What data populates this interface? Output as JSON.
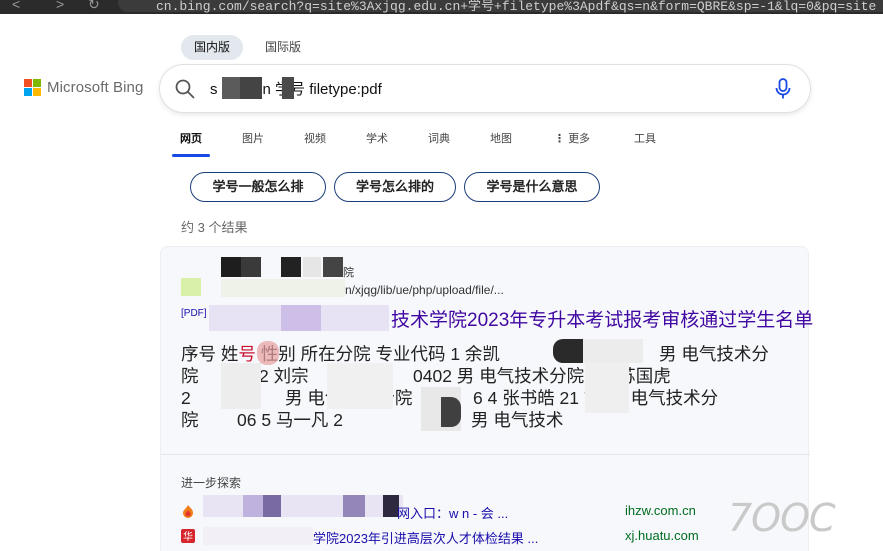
{
  "browser": {
    "url": "cn.bing.com/search?q=site%3Axjqg.edu.cn+学号+filetype%3Apdf&qs=n&form=QBRE&sp=-1&lq=0&pq=site"
  },
  "region_tabs": [
    {
      "label": "国内版",
      "active": true
    },
    {
      "label": "国际版",
      "active": false
    }
  ],
  "logo": {
    "name": "Microsoft Bing",
    "colors": [
      "#f25022",
      "#7fba00",
      "#00a4ef",
      "#ffb900"
    ]
  },
  "search": {
    "query": "s      u.cn 学号 filetype:pdf",
    "icon": "search-icon",
    "mic_icon": "microphone-icon"
  },
  "scopes": [
    {
      "label": "网页",
      "active": true
    },
    {
      "label": "图片",
      "active": false
    },
    {
      "label": "视频",
      "active": false
    },
    {
      "label": "学术",
      "active": false
    },
    {
      "label": "词典",
      "active": false
    },
    {
      "label": "地图",
      "active": false
    },
    {
      "label": "更多",
      "active": false,
      "icon": "more-vertical-icon"
    },
    {
      "label": "工具",
      "active": false
    }
  ],
  "related_chips": [
    "学号一般怎么排",
    "学号怎么排的",
    "学号是什么意思"
  ],
  "result_count": "约 3 个结果",
  "result": {
    "site_name": "院",
    "cite": "n/xjqg/lib/ue/php/upload/file/...",
    "pdf_tag": "[PDF]",
    "title": "技术学院2023年专升本考试报考审核通过学生名单",
    "snippet_rows": [
      {
        "before": "序号 姓",
        "hl": "号",
        "after": " 性别 所在分院 专业代码 1 余凯",
        "tail": "男 电气技术分"
      },
      {
        "before": "院",
        "hl": "",
        "after": "2 刘宗",
        "tail": "0402 男 电气技术分院 4        3 苏国虎"
      },
      {
        "before": "2",
        "hl": "",
        "after": "男 电气技术分院",
        "tail": "6 4 张书皓 21          76 男 电气技术分"
      },
      {
        "before": "院",
        "hl": "",
        "after": "06 5 马一凡 2",
        "tail": "男 电气技术"
      }
    ],
    "further_label": "进一步探索",
    "related": [
      {
        "text": "网入口：w           n - 会 ...",
        "domain": "ihzw.com.cn",
        "icon": "fire-icon"
      },
      {
        "text": "学院2023年引进高层次人才体检结果 ...",
        "domain": "xj.huatu.com",
        "icon": "huatu-icon"
      }
    ]
  },
  "watermark": "7OOC",
  "colors": {
    "accent": "#174ae4",
    "title": "#4007a2",
    "link": "#1a0dab",
    "domain": "#006d21",
    "chip_border": "#1a3e78"
  }
}
